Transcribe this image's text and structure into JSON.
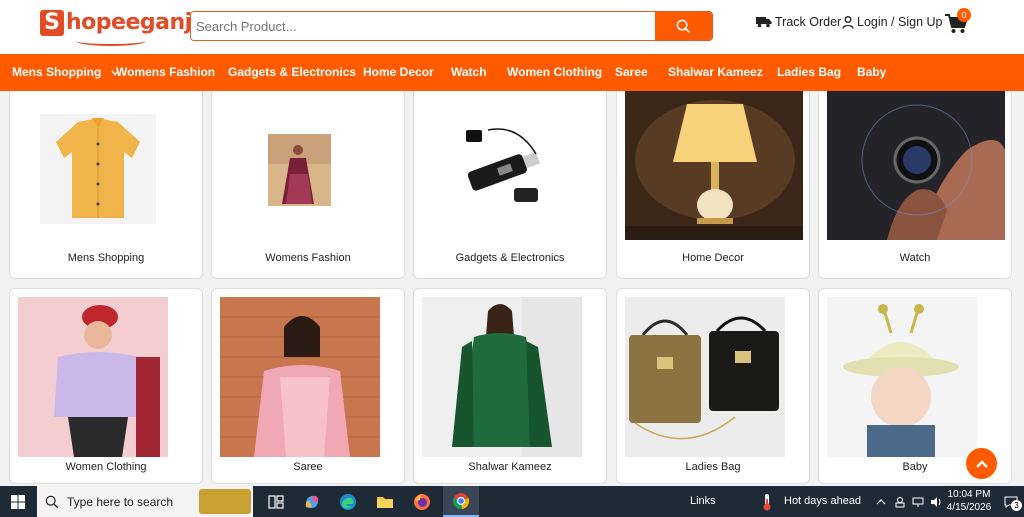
{
  "brand": {
    "logo_letter": "S",
    "logo_text": "hopeeganj"
  },
  "search": {
    "placeholder": "Search Product..."
  },
  "header": {
    "track_order": "Track Order",
    "login": "Login / Sign Up",
    "cart_count": "0"
  },
  "nav": {
    "items": [
      "Mens Shopping",
      "Womens Fashion",
      "Gadgets & Electronics",
      "Home Decor",
      "Watch",
      "Women Clothing",
      "Saree",
      "Shalwar Kameez",
      "Ladies Bag",
      "Baby"
    ]
  },
  "categories": [
    {
      "label": "Mens Shopping",
      "image": "yellow shirt"
    },
    {
      "label": "Womens Fashion",
      "image": "lehenga"
    },
    {
      "label": "Gadgets & Electronics",
      "image": "usb voice recorder"
    },
    {
      "label": "Home Decor",
      "image": "table lamp"
    },
    {
      "label": "Watch",
      "image": "smart watch"
    },
    {
      "label": "Women Clothing",
      "image": "woman in lavender top"
    },
    {
      "label": "Saree",
      "image": "woman in pink saree"
    },
    {
      "label": "Shalwar Kameez",
      "image": "green kameez"
    },
    {
      "label": "Ladies Bag",
      "image": "two handbags"
    },
    {
      "label": "Baby",
      "image": "baby with bucket hat"
    }
  ],
  "taskbar": {
    "search_placeholder": "Type here to search",
    "links": "Links",
    "weather": "Hot days ahead",
    "time": "10:04 PM",
    "date": "4/15/2026",
    "notification_count": "3"
  },
  "colors": {
    "accent": "#ff5a00",
    "brand": "#e24b26"
  }
}
